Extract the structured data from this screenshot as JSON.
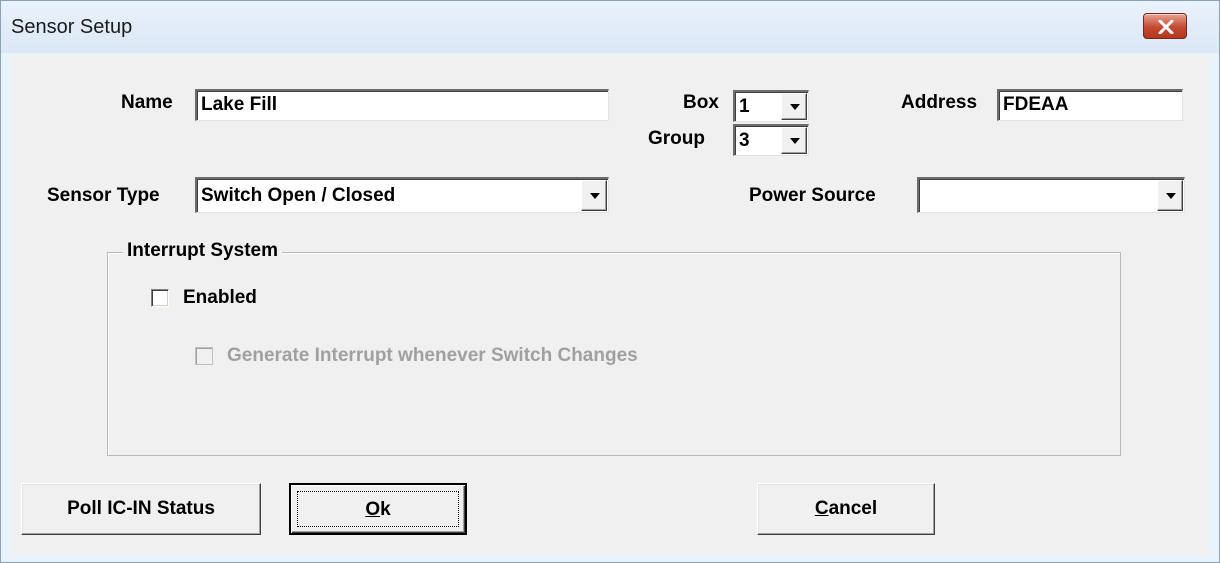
{
  "window": {
    "title": "Sensor Setup",
    "close_icon": "close-icon"
  },
  "fields": {
    "name_label": "Name",
    "name_value": "Lake Fill",
    "box_label": "Box",
    "box_value": "1",
    "group_label": "Group",
    "group_value": "3",
    "address_label": "Address",
    "address_value": "FDEAA",
    "sensor_type_label": "Sensor Type",
    "sensor_type_value": "Switch Open / Closed",
    "power_source_label": "Power Source",
    "power_source_value": ""
  },
  "interrupt_group": {
    "label": "Interrupt System",
    "enabled_label": "Enabled",
    "enabled_checked": false,
    "generate_label": "Generate Interrupt whenever Switch Changes",
    "generate_checked": false,
    "generate_disabled": true
  },
  "buttons": {
    "poll_label": "Poll IC-IN Status",
    "ok_mnemonic": "O",
    "ok_rest": "k",
    "cancel_mnemonic": "C",
    "cancel_rest": "ancel"
  },
  "colors": {
    "close_button": "#c24a31",
    "dialog_bg": "#f0f0f0",
    "disabled_text": "#a0a0a0"
  }
}
